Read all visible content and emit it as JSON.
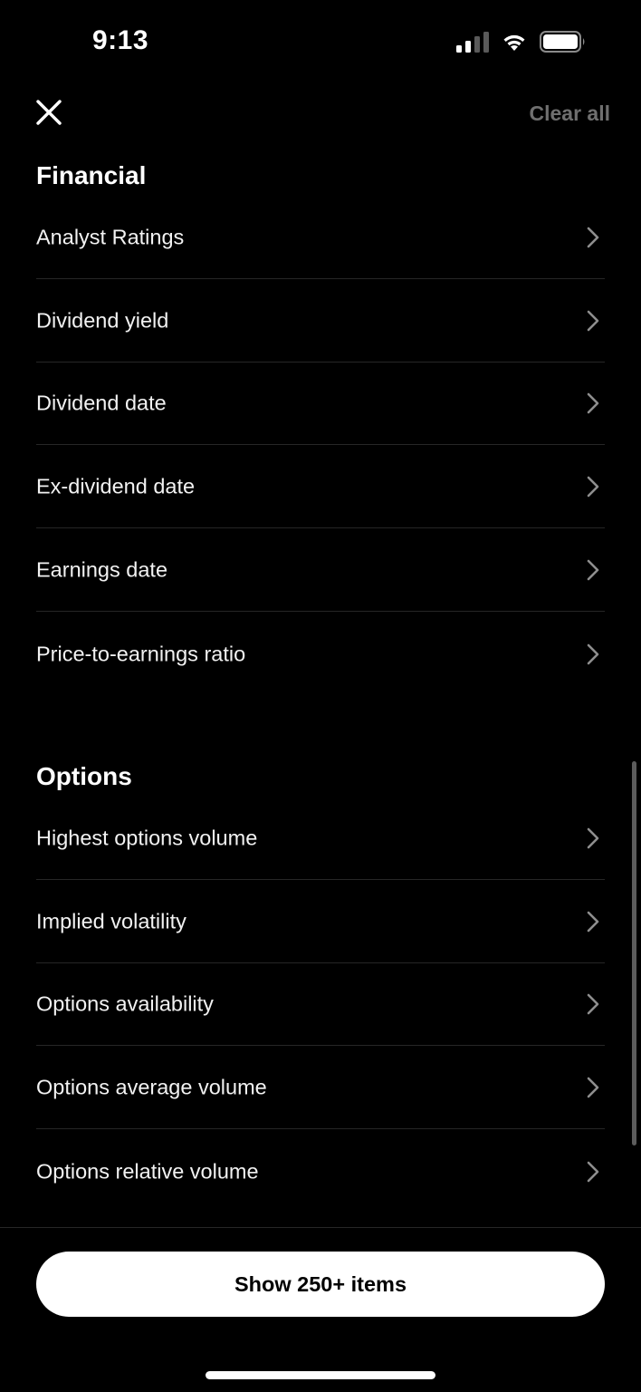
{
  "status_bar": {
    "time": "9:13",
    "icons": [
      "cellular-signal-icon",
      "wifi-icon",
      "battery-icon"
    ]
  },
  "header": {
    "close_icon": "close-icon",
    "clear_all_label": "Clear all"
  },
  "sections": [
    {
      "title": "Financial",
      "items": [
        {
          "label": "Analyst Ratings"
        },
        {
          "label": "Dividend yield"
        },
        {
          "label": "Dividend date"
        },
        {
          "label": "Ex-dividend date"
        },
        {
          "label": "Earnings date"
        },
        {
          "label": "Price-to-earnings ratio"
        }
      ]
    },
    {
      "title": "Options",
      "items": [
        {
          "label": "Highest options volume"
        },
        {
          "label": "Implied volatility"
        },
        {
          "label": "Options availability"
        },
        {
          "label": "Options average volume"
        },
        {
          "label": "Options relative volume"
        }
      ]
    }
  ],
  "footer": {
    "show_button_label": "Show 250+ items"
  },
  "colors": {
    "background": "#000000",
    "text": "#ffffff",
    "muted": "#6f6f6f",
    "divider": "#262626",
    "button_bg": "#ffffff"
  }
}
